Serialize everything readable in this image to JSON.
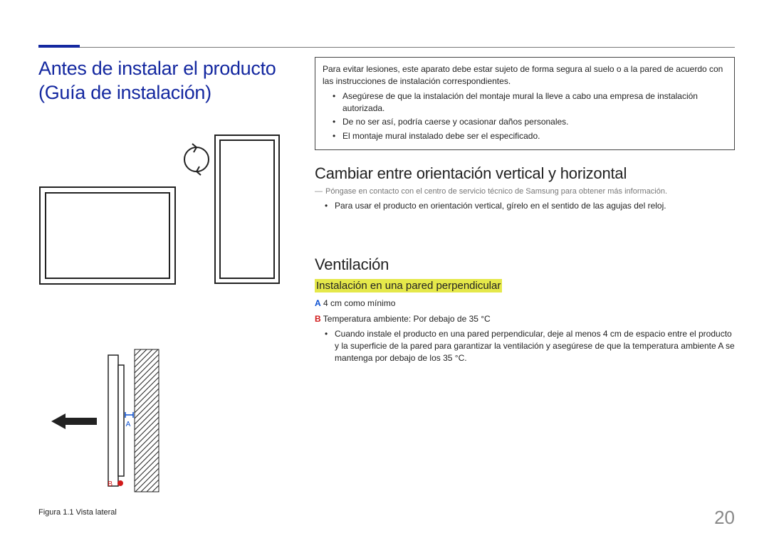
{
  "header": {
    "title": "Antes de instalar el producto (Guía de instalación)"
  },
  "warning": {
    "lead": "Para evitar lesiones, este aparato debe estar sujeto de forma segura al suelo o a la pared de acuerdo con las instrucciones de instalación correspondientes.",
    "items": [
      "Asegúrese de que la instalación del montaje mural la lleve a cabo una empresa de instalación autorizada.",
      "De no ser así, podría caerse y ocasionar daños personales.",
      "El montaje mural instalado debe ser el especificado."
    ]
  },
  "orientation": {
    "heading": "Cambiar entre orientación vertical y horizontal",
    "note": "Póngase en contacto con el centro de servicio técnico de Samsung para obtener más información.",
    "items": [
      "Para usar el producto en orientación vertical, gírelo en el sentido de las agujas del reloj."
    ]
  },
  "ventilation": {
    "heading": "Ventilación",
    "subheading": "Instalación en una pared perpendicular",
    "spec_a_label": "A",
    "spec_a_text": " 4 cm como mínimo",
    "spec_b_label": "B",
    "spec_b_text": " Temperatura ambiente: Por debajo de 35 °C",
    "items": [
      "Cuando instale el producto en una pared perpendicular, deje al menos 4 cm de espacio entre el producto y la superficie de la pared para garantizar la ventilación y asegúrese de que la temperatura ambiente A se mantenga por debajo de los 35 °C."
    ]
  },
  "figure": {
    "caption": "Figura 1.1 Vista lateral",
    "label_a": "A",
    "label_b": "B"
  },
  "page_number": "20"
}
